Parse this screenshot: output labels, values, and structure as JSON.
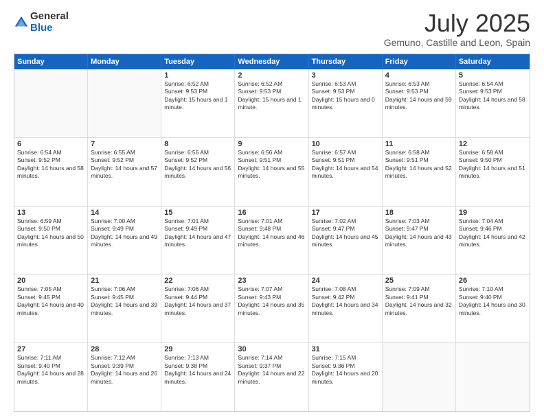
{
  "logo": {
    "general": "General",
    "blue": "Blue"
  },
  "title": "July 2025",
  "subtitle": "Gemuno, Castille and Leon, Spain",
  "header_days": [
    "Sunday",
    "Monday",
    "Tuesday",
    "Wednesday",
    "Thursday",
    "Friday",
    "Saturday"
  ],
  "weeks": [
    [
      {
        "day": "",
        "sunrise": "",
        "sunset": "",
        "daylight": ""
      },
      {
        "day": "",
        "sunrise": "",
        "sunset": "",
        "daylight": ""
      },
      {
        "day": "1",
        "sunrise": "Sunrise: 6:52 AM",
        "sunset": "Sunset: 9:53 PM",
        "daylight": "Daylight: 15 hours and 1 minute."
      },
      {
        "day": "2",
        "sunrise": "Sunrise: 6:52 AM",
        "sunset": "Sunset: 9:53 PM",
        "daylight": "Daylight: 15 hours and 1 minute."
      },
      {
        "day": "3",
        "sunrise": "Sunrise: 6:53 AM",
        "sunset": "Sunset: 9:53 PM",
        "daylight": "Daylight: 15 hours and 0 minutes."
      },
      {
        "day": "4",
        "sunrise": "Sunrise: 6:53 AM",
        "sunset": "Sunset: 9:53 PM",
        "daylight": "Daylight: 14 hours and 59 minutes."
      },
      {
        "day": "5",
        "sunrise": "Sunrise: 6:54 AM",
        "sunset": "Sunset: 9:53 PM",
        "daylight": "Daylight: 14 hours and 58 minutes."
      }
    ],
    [
      {
        "day": "6",
        "sunrise": "Sunrise: 6:54 AM",
        "sunset": "Sunset: 9:52 PM",
        "daylight": "Daylight: 14 hours and 58 minutes."
      },
      {
        "day": "7",
        "sunrise": "Sunrise: 6:55 AM",
        "sunset": "Sunset: 9:52 PM",
        "daylight": "Daylight: 14 hours and 57 minutes."
      },
      {
        "day": "8",
        "sunrise": "Sunrise: 6:56 AM",
        "sunset": "Sunset: 9:52 PM",
        "daylight": "Daylight: 14 hours and 56 minutes."
      },
      {
        "day": "9",
        "sunrise": "Sunrise: 6:56 AM",
        "sunset": "Sunset: 9:51 PM",
        "daylight": "Daylight: 14 hours and 55 minutes."
      },
      {
        "day": "10",
        "sunrise": "Sunrise: 6:57 AM",
        "sunset": "Sunset: 9:51 PM",
        "daylight": "Daylight: 14 hours and 54 minutes."
      },
      {
        "day": "11",
        "sunrise": "Sunrise: 6:58 AM",
        "sunset": "Sunset: 9:51 PM",
        "daylight": "Daylight: 14 hours and 52 minutes."
      },
      {
        "day": "12",
        "sunrise": "Sunrise: 6:58 AM",
        "sunset": "Sunset: 9:50 PM",
        "daylight": "Daylight: 14 hours and 51 minutes."
      }
    ],
    [
      {
        "day": "13",
        "sunrise": "Sunrise: 6:59 AM",
        "sunset": "Sunset: 9:50 PM",
        "daylight": "Daylight: 14 hours and 50 minutes."
      },
      {
        "day": "14",
        "sunrise": "Sunrise: 7:00 AM",
        "sunset": "Sunset: 9:49 PM",
        "daylight": "Daylight: 14 hours and 49 minutes."
      },
      {
        "day": "15",
        "sunrise": "Sunrise: 7:01 AM",
        "sunset": "Sunset: 9:49 PM",
        "daylight": "Daylight: 14 hours and 47 minutes."
      },
      {
        "day": "16",
        "sunrise": "Sunrise: 7:01 AM",
        "sunset": "Sunset: 9:48 PM",
        "daylight": "Daylight: 14 hours and 46 minutes."
      },
      {
        "day": "17",
        "sunrise": "Sunrise: 7:02 AM",
        "sunset": "Sunset: 9:47 PM",
        "daylight": "Daylight: 14 hours and 45 minutes."
      },
      {
        "day": "18",
        "sunrise": "Sunrise: 7:03 AM",
        "sunset": "Sunset: 9:47 PM",
        "daylight": "Daylight: 14 hours and 43 minutes."
      },
      {
        "day": "19",
        "sunrise": "Sunrise: 7:04 AM",
        "sunset": "Sunset: 9:46 PM",
        "daylight": "Daylight: 14 hours and 42 minutes."
      }
    ],
    [
      {
        "day": "20",
        "sunrise": "Sunrise: 7:05 AM",
        "sunset": "Sunset: 9:45 PM",
        "daylight": "Daylight: 14 hours and 40 minutes."
      },
      {
        "day": "21",
        "sunrise": "Sunrise: 7:06 AM",
        "sunset": "Sunset: 9:45 PM",
        "daylight": "Daylight: 14 hours and 39 minutes."
      },
      {
        "day": "22",
        "sunrise": "Sunrise: 7:06 AM",
        "sunset": "Sunset: 9:44 PM",
        "daylight": "Daylight: 14 hours and 37 minutes."
      },
      {
        "day": "23",
        "sunrise": "Sunrise: 7:07 AM",
        "sunset": "Sunset: 9:43 PM",
        "daylight": "Daylight: 14 hours and 35 minutes."
      },
      {
        "day": "24",
        "sunrise": "Sunrise: 7:08 AM",
        "sunset": "Sunset: 9:42 PM",
        "daylight": "Daylight: 14 hours and 34 minutes."
      },
      {
        "day": "25",
        "sunrise": "Sunrise: 7:09 AM",
        "sunset": "Sunset: 9:41 PM",
        "daylight": "Daylight: 14 hours and 32 minutes."
      },
      {
        "day": "26",
        "sunrise": "Sunrise: 7:10 AM",
        "sunset": "Sunset: 9:40 PM",
        "daylight": "Daylight: 14 hours and 30 minutes."
      }
    ],
    [
      {
        "day": "27",
        "sunrise": "Sunrise: 7:11 AM",
        "sunset": "Sunset: 9:40 PM",
        "daylight": "Daylight: 14 hours and 28 minutes."
      },
      {
        "day": "28",
        "sunrise": "Sunrise: 7:12 AM",
        "sunset": "Sunset: 9:39 PM",
        "daylight": "Daylight: 14 hours and 26 minutes."
      },
      {
        "day": "29",
        "sunrise": "Sunrise: 7:13 AM",
        "sunset": "Sunset: 9:38 PM",
        "daylight": "Daylight: 14 hours and 24 minutes."
      },
      {
        "day": "30",
        "sunrise": "Sunrise: 7:14 AM",
        "sunset": "Sunset: 9:37 PM",
        "daylight": "Daylight: 14 hours and 22 minutes."
      },
      {
        "day": "31",
        "sunrise": "Sunrise: 7:15 AM",
        "sunset": "Sunset: 9:36 PM",
        "daylight": "Daylight: 14 hours and 20 minutes."
      },
      {
        "day": "",
        "sunrise": "",
        "sunset": "",
        "daylight": ""
      },
      {
        "day": "",
        "sunrise": "",
        "sunset": "",
        "daylight": ""
      }
    ]
  ]
}
